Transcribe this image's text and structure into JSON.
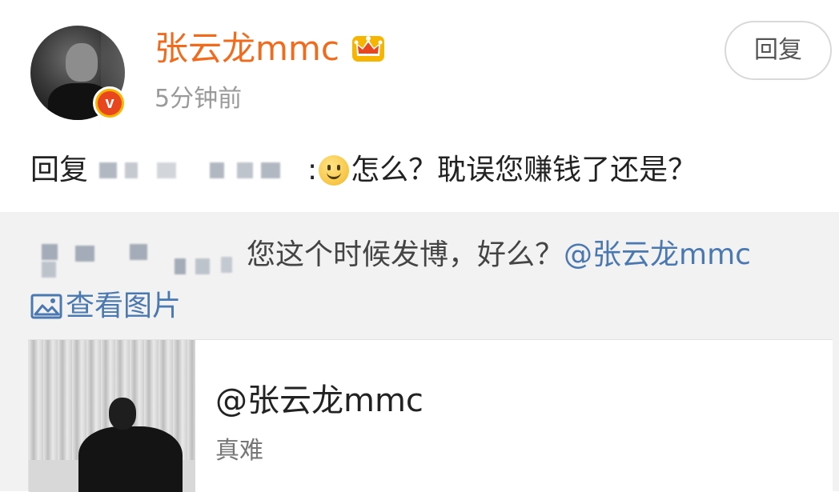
{
  "comment": {
    "username": "张云龙mmc",
    "timestamp": "5分钟前",
    "reply_button_label": "回复",
    "reply_prefix": "回复",
    "reply_colon": ":",
    "reply_text": "怎么？耽误您赚钱了还是？",
    "badge_letter": "v",
    "icons": {
      "avatar": "avatar-photo",
      "verified": "verified-v-badge-icon",
      "crown": "crown-icon",
      "emoji": "smile-emoji-icon"
    },
    "colors": {
      "username": "#f26b1d",
      "verified_badge": "#e8461f",
      "link": "#4a78b0"
    }
  },
  "quoted": {
    "text": "您这个时候发博，好么？",
    "mention": "@张云龙mmc",
    "view_images_label": "查看图片",
    "view_images_icon": "image-icon"
  },
  "card": {
    "title": "@张云龙mmc",
    "subtitle": "真难",
    "thumbnail_icon": "photo-thumbnail"
  }
}
